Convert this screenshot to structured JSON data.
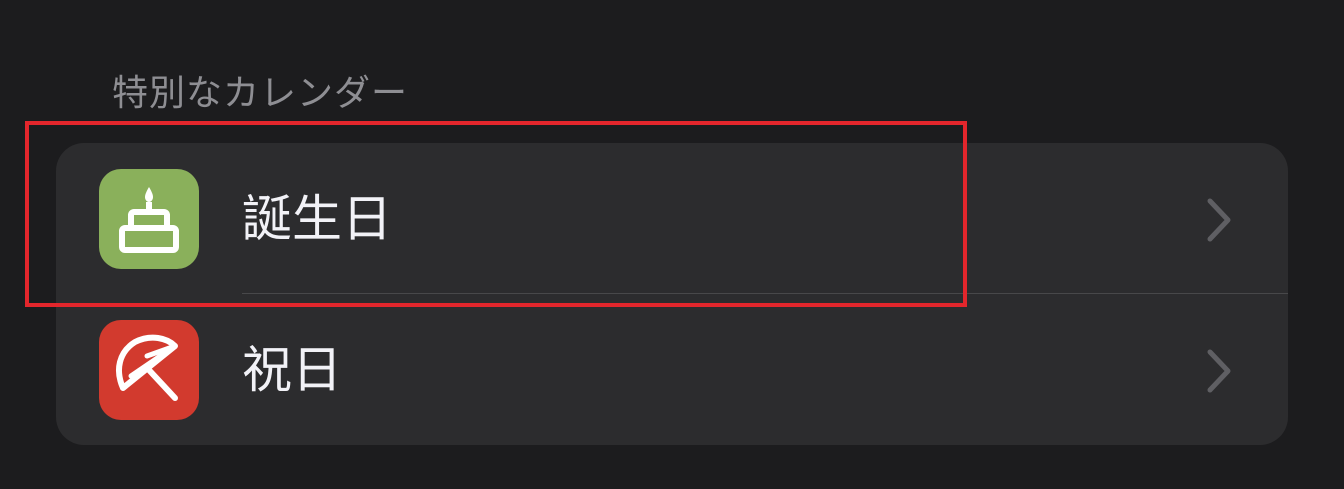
{
  "section": {
    "header": "特別なカレンダー"
  },
  "rows": [
    {
      "label": "誕生日",
      "icon": "birthday-cake-icon",
      "icon_bg": "#8ab05b"
    },
    {
      "label": "祝日",
      "icon": "umbrella-icon",
      "icon_bg": "#d23a2e"
    }
  ],
  "colors": {
    "background": "#1c1c1e",
    "group_background": "#2c2c2e",
    "highlight": "#e3262c",
    "chevron": "#5f5f63"
  }
}
